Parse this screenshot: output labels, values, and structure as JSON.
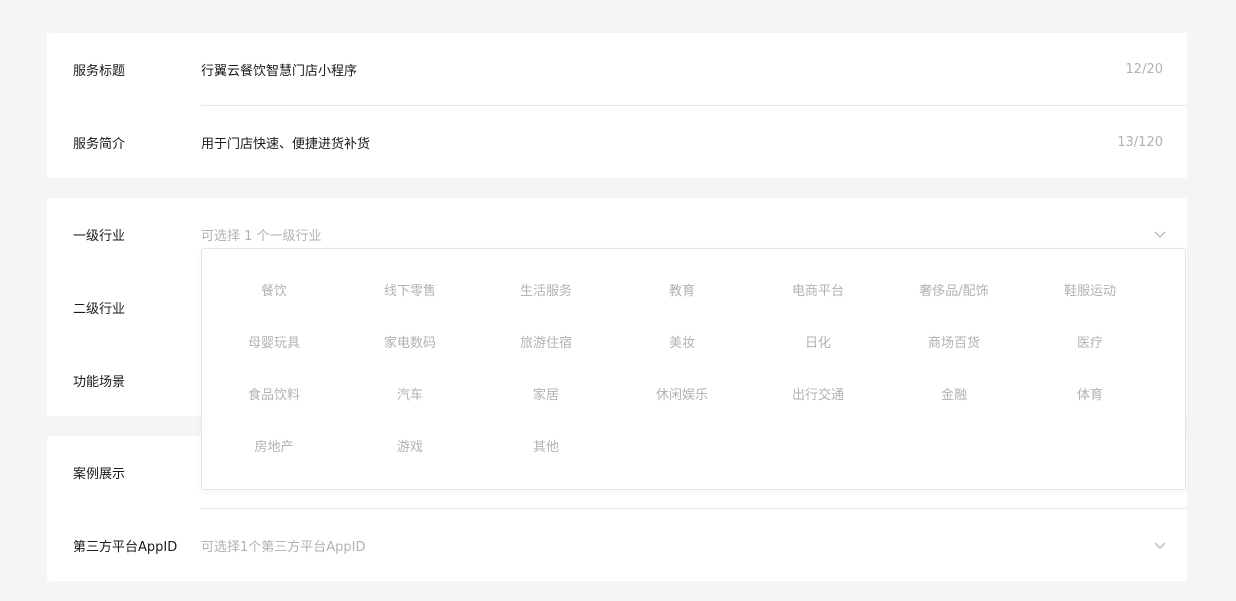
{
  "page": {
    "title": ""
  },
  "basic": {
    "title_label": "服务标题",
    "title_value": "行翼云餐饮智慧门店小程序",
    "title_count": "12/20",
    "intro_label": "服务简介",
    "intro_value": "用于门店快速、便捷进货补货",
    "intro_count": "13/120"
  },
  "category": {
    "level1_label": "一级行业",
    "level1_placeholder": "可选择 1 个一级行业",
    "level2_label": "二级行业",
    "scene_label": "功能场景"
  },
  "extra": {
    "case_label": "案例展示",
    "appid_label": "第三方平台AppID",
    "appid_placeholder": "可选择1个第三方平台AppID"
  },
  "dropdown": {
    "options": [
      "餐饮",
      "线下零售",
      "生活服务",
      "教育",
      "电商平台",
      "奢侈品/配饰",
      "鞋服运动",
      "母婴玩具",
      "家电数码",
      "旅游住宿",
      "美妆",
      "日化",
      "商场百货",
      "医疗",
      "食品饮料",
      "汽车",
      "家居",
      "休闲娱乐",
      "出行交通",
      "金融",
      "体育",
      "房地产",
      "游戏",
      "其他"
    ]
  },
  "icons": {
    "dropdown_arrow": "chevron-down-icon"
  }
}
